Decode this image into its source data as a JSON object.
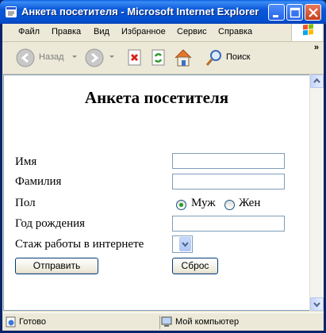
{
  "window": {
    "title": "Анкета посетителя - Microsoft Internet Explorer"
  },
  "menubar": {
    "items": [
      {
        "label": "Файл"
      },
      {
        "label": "Правка"
      },
      {
        "label": "Вид"
      },
      {
        "label": "Избранное"
      },
      {
        "label": "Сервис"
      },
      {
        "label": "Справка"
      }
    ]
  },
  "toolbar": {
    "back_label": "Назад",
    "search_label": "Поиск",
    "more_label": "»"
  },
  "form": {
    "title": "Анкета посетителя",
    "first_name_label": "Имя",
    "first_name_value": "",
    "last_name_label": "Фамилия",
    "last_name_value": "",
    "gender_label": "Пол",
    "gender_options": [
      {
        "label": "Муж",
        "checked": true
      },
      {
        "label": "Жен",
        "checked": false
      }
    ],
    "birth_year_label": "Год рождения",
    "birth_year_value": "",
    "experience_label": "Стаж работы в интернете",
    "experience_value": "",
    "submit_label": "Отправить",
    "reset_label": "Сброс"
  },
  "statusbar": {
    "status": "Готово",
    "zone": "Мой компьютер"
  }
}
